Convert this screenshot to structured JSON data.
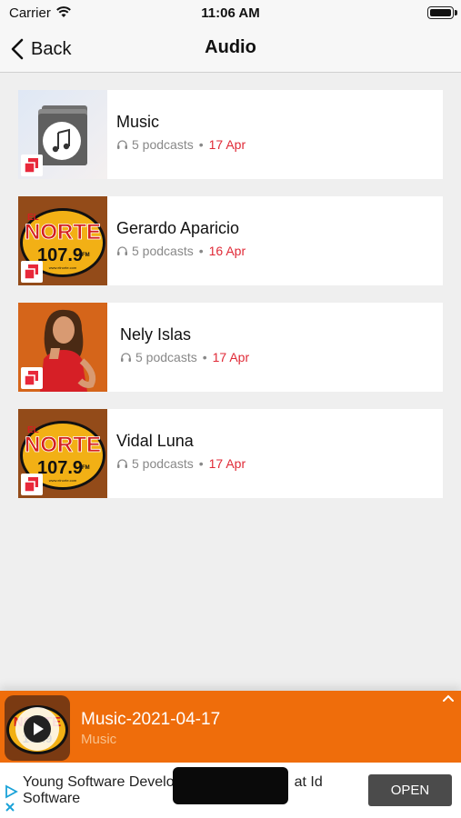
{
  "status": {
    "carrier": "Carrier",
    "time": "11:06 AM"
  },
  "nav": {
    "back_label": "Back",
    "title": "Audio"
  },
  "items": [
    {
      "title": "Music",
      "count": "5 podcasts",
      "date": "17 Apr",
      "image": "music-folder-icon"
    },
    {
      "title": "Gerardo Aparicio",
      "count": "5 podcasts",
      "date": "16 Apr",
      "image": "el-norte-logo"
    },
    {
      "title": "Nely Islas",
      "count": "5 podcasts",
      "date": "17 Apr",
      "image": "host-photo"
    },
    {
      "title": "Vidal Luna",
      "count": "5 podcasts",
      "date": "17 Apr",
      "image": "el-norte-logo"
    }
  ],
  "logo": {
    "top": "EL",
    "name": "NORTE",
    "freq": "107.9",
    "fm": "FM",
    "url": "www.elnorte.com"
  },
  "player": {
    "title": "Music-2021-04-17",
    "subtitle": "Music"
  },
  "ad": {
    "text": "Young Software Develo      at Id Software",
    "line1": "Young Software Develo",
    "line1b": "at Id",
    "line2": "Software",
    "button": "OPEN"
  },
  "colors": {
    "accent": "#ef6d0b",
    "date": "#e02a37",
    "badge": "#e8283a"
  }
}
